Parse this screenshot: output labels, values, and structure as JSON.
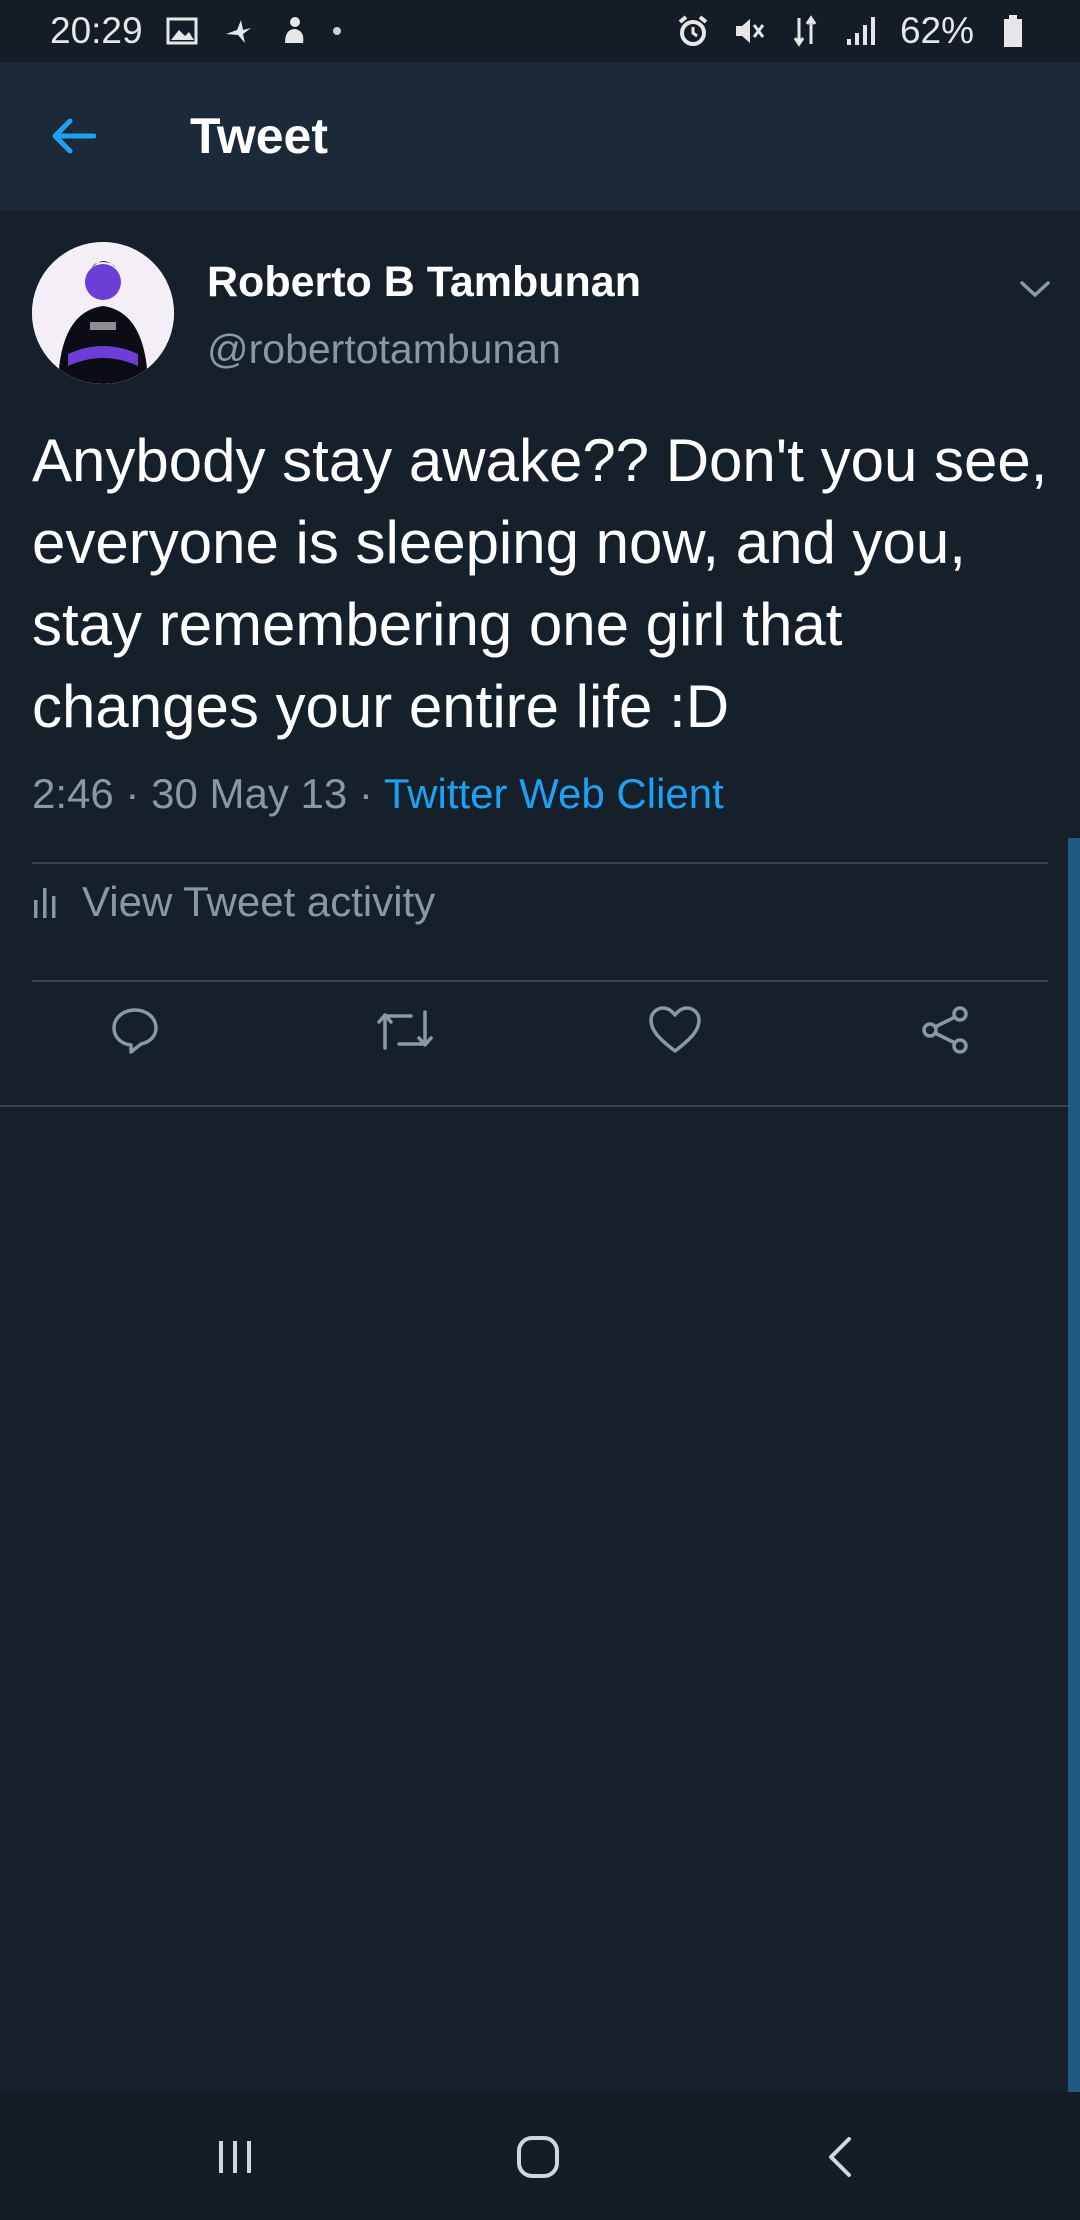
{
  "status_bar": {
    "time": "20:29",
    "battery": "62%",
    "left_icons": [
      "image-icon",
      "bird-icon",
      "pet-icon",
      "dot-icon"
    ],
    "right_icons": [
      "alarm-icon",
      "mute-icon",
      "data-arrows-icon",
      "signal-icon",
      "battery-icon"
    ]
  },
  "header": {
    "title": "Tweet",
    "back_icon": "arrow-left-icon",
    "accent": "#1da1f2"
  },
  "tweet": {
    "author_name": "Roberto B Tambunan",
    "author_handle": "@robertotambunan",
    "text": "Anybody stay awake?? Don't you see, everyone is sleeping now, and you, stay remembering one girl that changes your entire life :D",
    "time": "2:46",
    "separator": "·",
    "date": "30 May 13",
    "client": "Twitter Web Client",
    "activity_label": "View Tweet activity",
    "actions": [
      "reply-icon",
      "retweet-icon",
      "like-icon",
      "share-icon"
    ]
  },
  "nav_bar": {
    "buttons": [
      "recent-apps-icon",
      "home-icon",
      "back-icon"
    ]
  },
  "colors": {
    "background": "#15202b",
    "header_bg": "#1c2938",
    "secondary_text": "#8899a6",
    "link": "#1da1f2",
    "divider": "#38444d"
  }
}
